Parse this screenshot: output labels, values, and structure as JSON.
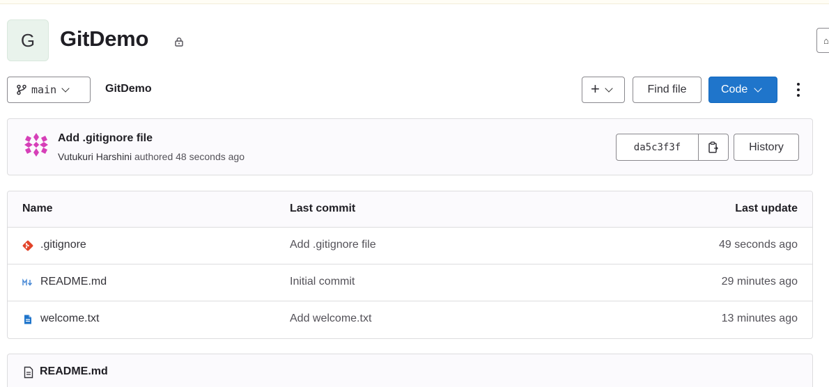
{
  "project": {
    "avatar_letter": "G",
    "name": "GitDemo",
    "visibility_icon": "lock-icon"
  },
  "toolbar": {
    "branch_icon": "branch-icon",
    "branch": "main",
    "breadcrumb": "GitDemo",
    "add_label": "+",
    "find_file_label": "Find file",
    "code_label": "Code",
    "more_icon": "kebab-menu-icon",
    "code_button_color": "#1f75cb"
  },
  "last_commit": {
    "title": "Add .gitignore file",
    "author": "Vutukuri Harshini",
    "meta": "authored 48 seconds ago",
    "sha": "da5c3f3f",
    "copy_icon": "copy-icon",
    "history_label": "History",
    "avatar_color": "#d63fb8"
  },
  "files": {
    "headers": {
      "name": "Name",
      "last_commit": "Last commit",
      "last_update": "Last update"
    },
    "rows": [
      {
        "icon": "git-logo-icon",
        "name": ".gitignore",
        "commit": "Add .gitignore file",
        "updated": "49 seconds ago"
      },
      {
        "icon": "markdown-icon",
        "name": "README.md",
        "commit": "Initial commit",
        "updated": "29 minutes ago"
      },
      {
        "icon": "text-file-icon",
        "name": "welcome.txt",
        "commit": "Add welcome.txt",
        "updated": "13 minutes ago"
      }
    ]
  },
  "readme": {
    "icon": "document-icon",
    "title": "README.md"
  }
}
